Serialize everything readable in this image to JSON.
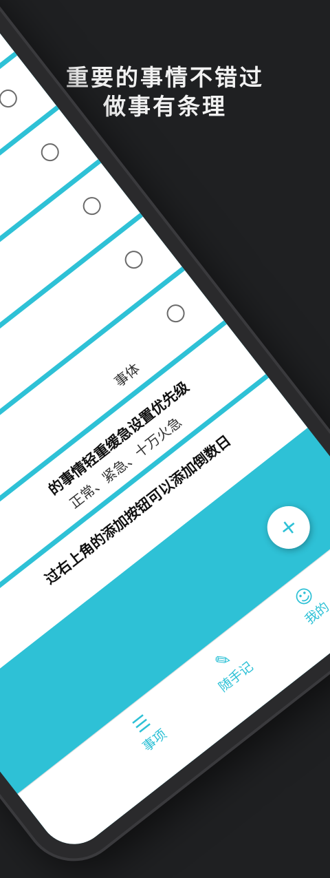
{
  "headline": {
    "line1": "重要的事情不错过",
    "line2": "做事有条理"
  },
  "items": [
    {
      "title": "",
      "detail": ""
    },
    {
      "title": "",
      "detail": ""
    },
    {
      "title": "",
      "detail": ""
    },
    {
      "title": "",
      "detail": ""
    },
    {
      "title": "",
      "detail": ""
    },
    {
      "title": "",
      "detail": "事体"
    },
    {
      "title": "的事情轻重缓急设置优先级",
      "detail": "正常、紧急、十万火急"
    },
    {
      "title": "过右上角的添加按钮可以添加倒数日",
      "detail": ""
    }
  ],
  "fab": {
    "icon": "+"
  },
  "tabbar": {
    "tabs": [
      {
        "label": "事项",
        "icon": "list-icon",
        "glyph": "☰"
      },
      {
        "label": "随手记",
        "icon": "pencil-icon",
        "glyph": "✎"
      },
      {
        "label": "我的",
        "icon": "person-icon",
        "glyph": "☺"
      }
    ]
  },
  "colors": {
    "accent": "#2ec1d6",
    "background": "#1f2022"
  }
}
